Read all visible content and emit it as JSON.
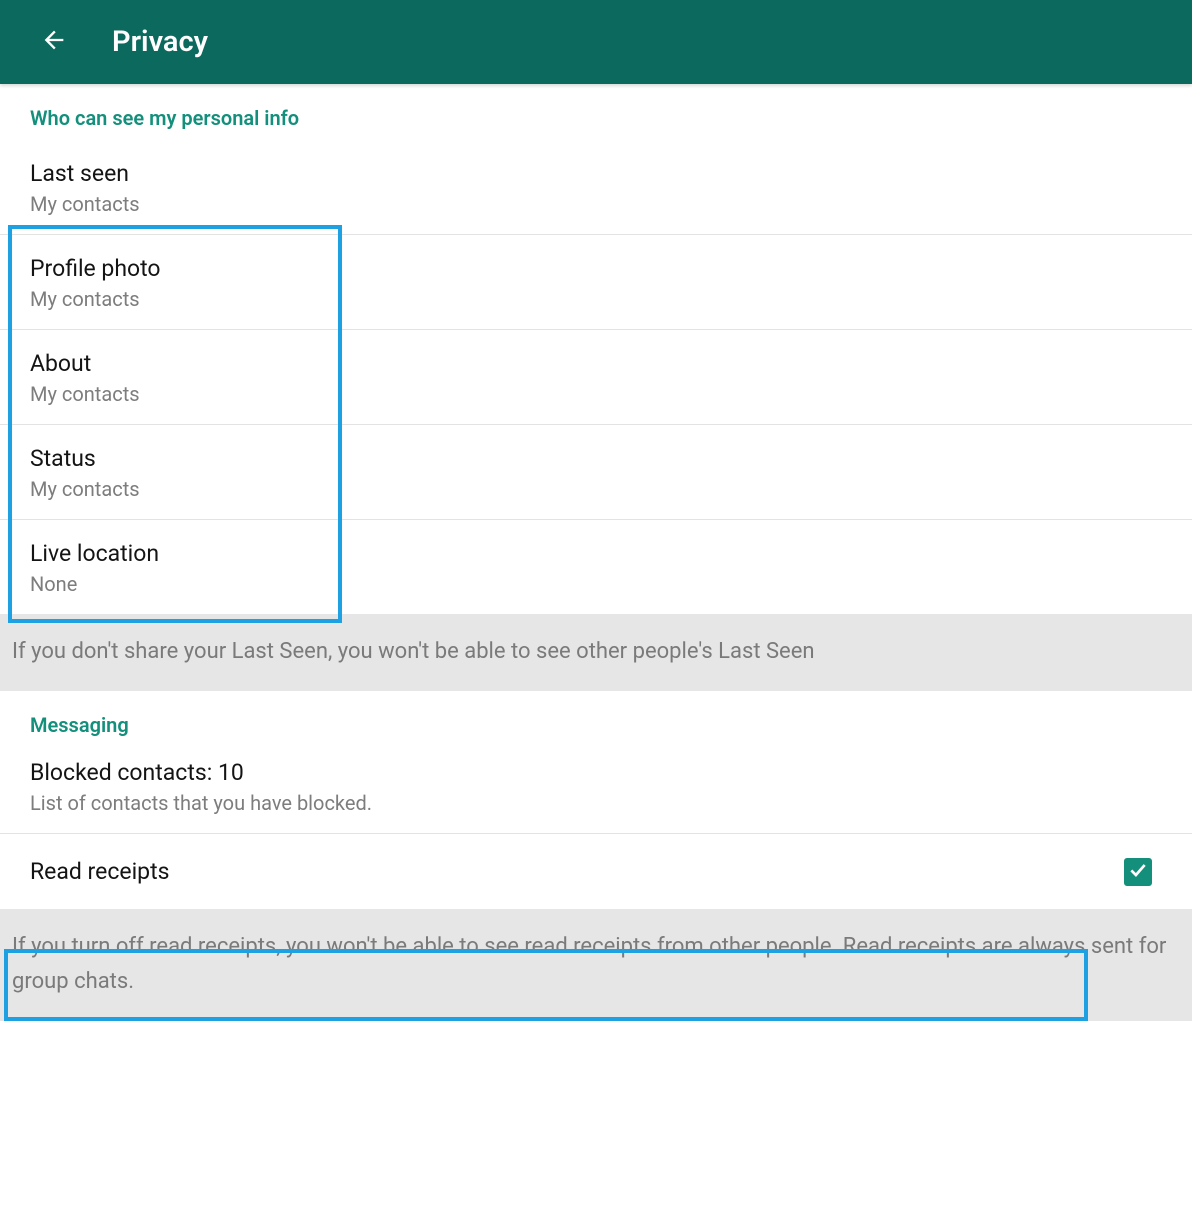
{
  "header": {
    "title": "Privacy"
  },
  "sections": {
    "personal_info_header": "Who can see my personal info",
    "messaging_header": "Messaging"
  },
  "settings": {
    "last_seen": {
      "title": "Last seen",
      "value": "My contacts"
    },
    "profile_photo": {
      "title": "Profile photo",
      "value": "My contacts"
    },
    "about": {
      "title": "About",
      "value": "My contacts"
    },
    "status": {
      "title": "Status",
      "value": "My contacts"
    },
    "live_location": {
      "title": "Live location",
      "value": "None"
    },
    "blocked": {
      "title": "Blocked contacts: 10",
      "sub": "List of contacts that you have blocked."
    },
    "read_receipts": {
      "title": "Read receipts",
      "checked": true
    }
  },
  "info": {
    "last_seen_note": "If you don't share your Last Seen, you won't be able to see other people's Last Seen",
    "read_receipts_note": "If you turn off read receipts, you won't be able to see read receipts from other people. Read receipts are always sent for group chats."
  }
}
